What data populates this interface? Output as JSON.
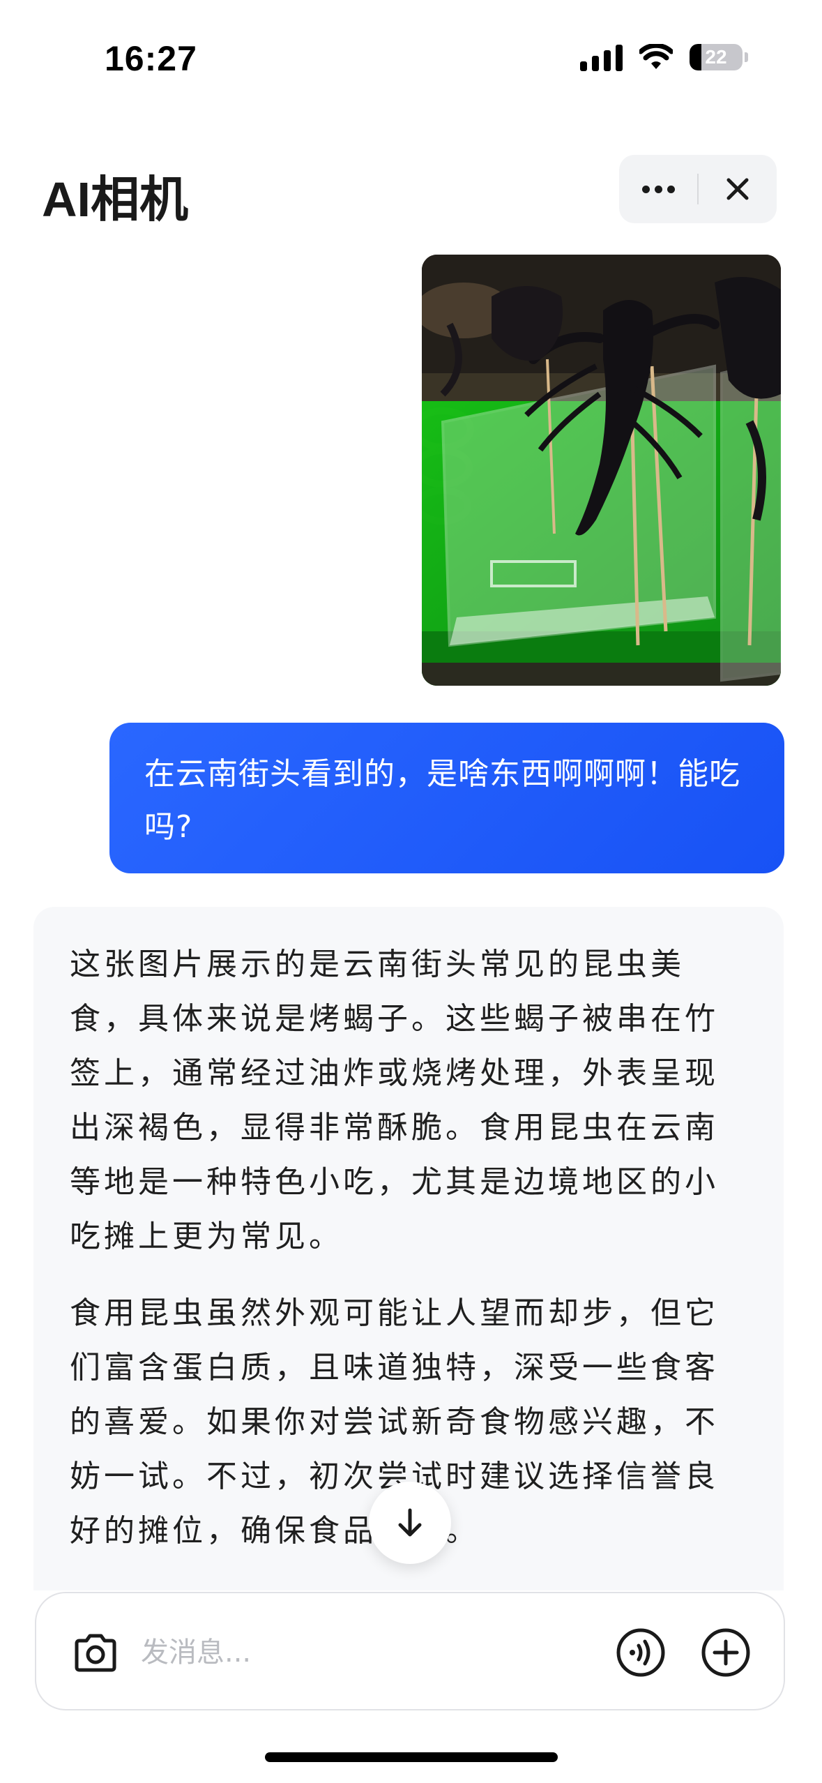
{
  "status_bar": {
    "time": "16:27",
    "battery": "22",
    "battery_level": 0.22,
    "icons": [
      "signal-icon",
      "wifi-icon",
      "battery-icon"
    ]
  },
  "header": {
    "title": "AI相机",
    "more_icon": "more-dots-icon",
    "close_icon": "close-icon"
  },
  "conversation": {
    "user_image": "photo of fried scorpions on skewers in a clear plastic box",
    "user_message": "在云南街头看到的，是啥东西啊啊啊！能吃吗?",
    "ai_paragraphs": [
      "这张图片展示的是云南街头常见的昆虫美食，具体来说是烤蝎子。这些蝎子被串在竹签上，通常经过油炸或烧烤处理，外表呈现出深褐色，显得非常酥脆。食用昆虫在云南等地是一种特色小吃，尤其是边境地区的小吃摊上更为常见。",
      "食用昆虫虽然外观可能让人望而却步，但它们富含蛋白质，且味道独特，深受一些食客的喜爱。如果你对尝试新奇食物感兴趣，不妨一试。不过，初次尝试时建议选择信誉良好的摊位，确保食品安全。"
    ],
    "scroll_down_icon": "arrow-down-icon"
  },
  "input_bar": {
    "placeholder": "发消息...",
    "left_icon": "camera-icon",
    "voice_icon": "voice-call-icon",
    "add_icon": "plus-circle-icon"
  },
  "colors": {
    "accent_blue": "#1852f5",
    "card_bg": "#f7f8fa",
    "placeholder": "#b9bbc0"
  }
}
